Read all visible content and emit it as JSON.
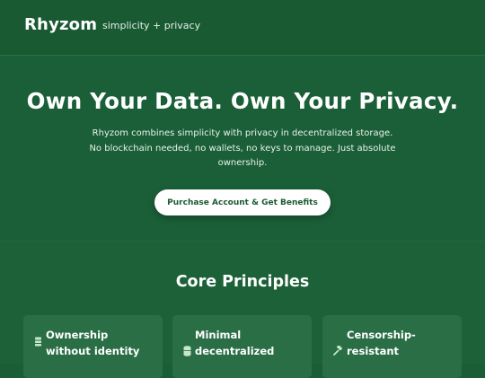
{
  "header": {
    "brand": "Rhyzom",
    "tagline": "simplicity + privacy"
  },
  "hero": {
    "title": "Own Your Data. Own Your Privacy.",
    "subtitle": "Rhyzom combines simplicity with privacy in decentralized storage. No blockchain needed, no wallets, no keys to manage. Just absolute ownership.",
    "cta_label": "Purchase Account & Get Benefits"
  },
  "principles": {
    "title": "Core Principles",
    "cards": [
      {
        "icon": "user-lock-icon",
        "title_line1": "Ownership",
        "title_line2": "without identity"
      },
      {
        "icon": "database-icon",
        "title_line1": "Minimal",
        "title_line2": "decentralized"
      },
      {
        "icon": "gavel-icon",
        "title_line1": "Censorship-",
        "title_line2": "resistant"
      }
    ]
  },
  "colors": {
    "background": "#1b5e36",
    "card": "#2a6e46",
    "button_text": "#195a33"
  }
}
